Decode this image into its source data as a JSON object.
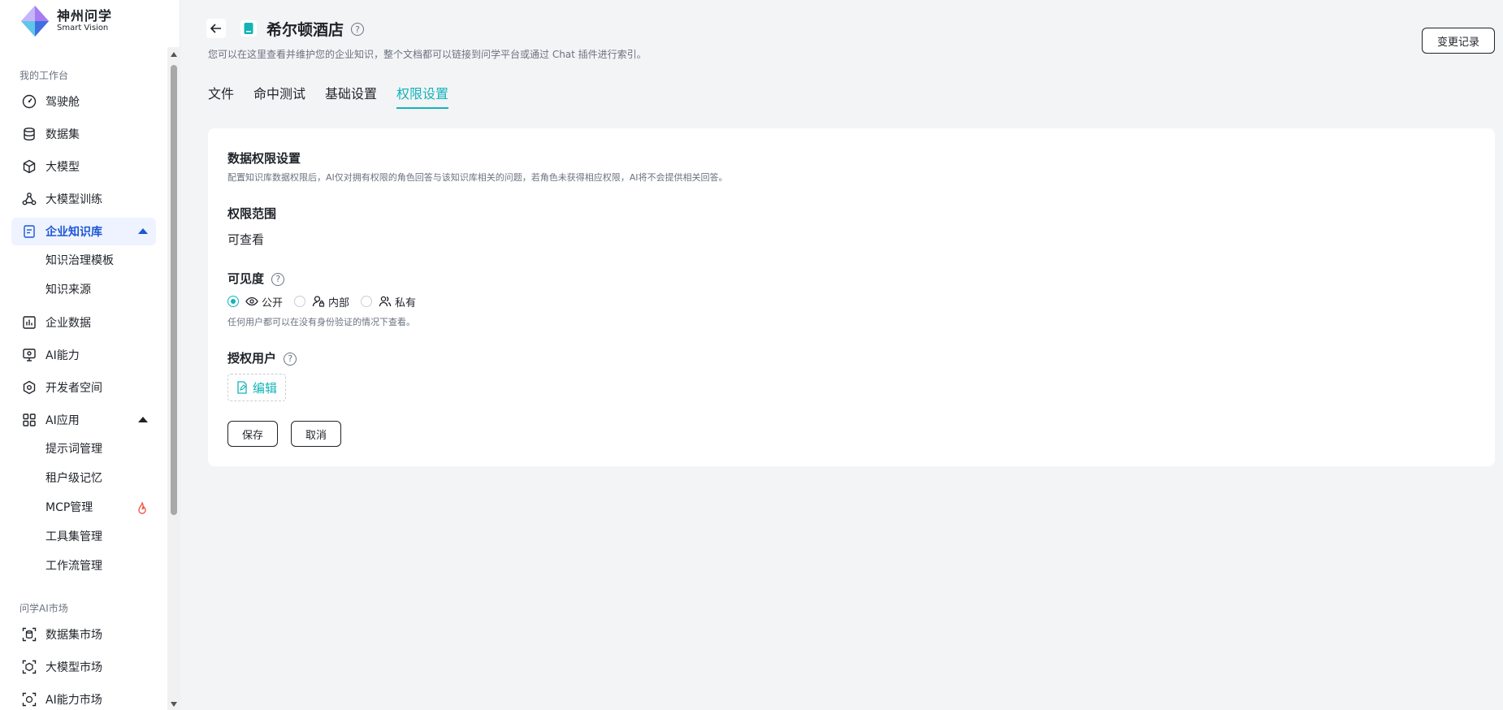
{
  "app": {
    "logo_title": "神州问学",
    "logo_sub": "Smart Vision"
  },
  "sidebar": {
    "section_workbench": "我的工作台",
    "items": [
      {
        "label": "驾驶舱",
        "icon": "dashboard-icon"
      },
      {
        "label": "数据集",
        "icon": "database-icon"
      },
      {
        "label": "大模型",
        "icon": "cube-icon"
      },
      {
        "label": "大模型训练",
        "icon": "training-icon"
      },
      {
        "label": "企业知识库",
        "icon": "knowledge-base-icon"
      },
      {
        "label": "企业数据",
        "icon": "bar-chart-icon"
      },
      {
        "label": "AI能力",
        "icon": "monitor-icon"
      },
      {
        "label": "开发者空间",
        "icon": "hexagon-icon"
      },
      {
        "label": "AI应用",
        "icon": "grid-icon"
      }
    ],
    "kb_sub": [
      "知识治理模板",
      "知识来源"
    ],
    "ai_app_sub": [
      "提示词管理",
      "租户级记忆",
      "MCP管理",
      "工具集管理",
      "工作流管理"
    ],
    "section_market": "问学AI市场",
    "market_items": [
      {
        "label": "数据集市场",
        "icon": "dataset-market-icon"
      },
      {
        "label": "大模型市场",
        "icon": "model-market-icon"
      },
      {
        "label": "AI能力市场",
        "icon": "ai-market-icon"
      }
    ]
  },
  "header": {
    "title": "希尔顿酒店",
    "help_glyph": "?",
    "subtitle": "您可以在这里查看并维护您的企业知识，整个文档都可以链接到问学平台或通过 Chat 插件进行索引。",
    "history_button": "变更记录"
  },
  "tabs": [
    "文件",
    "命中测试",
    "基础设置",
    "权限设置"
  ],
  "active_tab": "权限设置",
  "permission": {
    "section_title": "数据权限设置",
    "section_desc": "配置知识库数据权限后，AI仅对拥有权限的角色回答与该知识库相关的问题，若角色未获得相应权限，AI将不会提供相关回答。",
    "scope_label": "权限范围",
    "scope_value": "可查看",
    "visibility_label": "可见度",
    "visibility_options": [
      "公开",
      "内部",
      "私有"
    ],
    "visibility_selected": "公开",
    "visibility_desc": "任何用户都可以在没有身份验证的情况下查看。",
    "auth_users_label": "授权用户",
    "edit_button": "编辑",
    "save_button": "保存",
    "cancel_button": "取消"
  },
  "colors": {
    "accent": "#13b3b8",
    "nav_active": "#1d56d6",
    "fire": "#f05a4a"
  }
}
